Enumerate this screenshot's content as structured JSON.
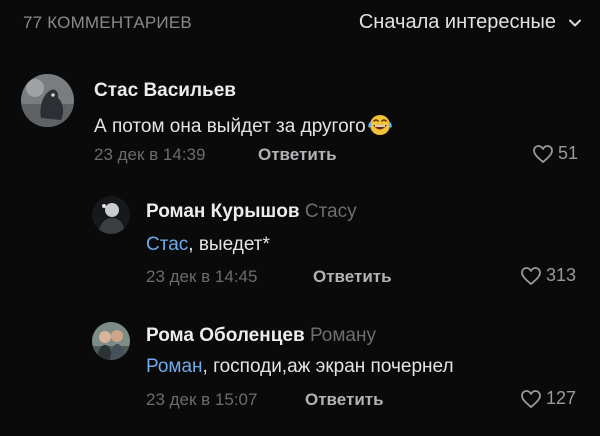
{
  "header": {
    "comment_count": "77 КОММЕНТАРИЕВ",
    "sort_label": "Сначала интересные"
  },
  "comments": [
    {
      "author": "Стас Васильев",
      "text": "А потом она выйдет за другого",
      "emoji": "😂",
      "date": "23 дек в 14:39",
      "reply_label": "Ответить",
      "likes": "51"
    },
    {
      "author": "Роман Курышов",
      "reply_to": "Стасу",
      "mention": "Стас",
      "text": ", выедет*",
      "date": "23 дек в 14:45",
      "reply_label": "Ответить",
      "likes": "313"
    },
    {
      "author": "Рома Оболенцев",
      "reply_to": "Роману",
      "mention": "Роман",
      "text": ", господи,аж экран почернел",
      "date": "23 дек в 15:07",
      "reply_label": "Ответить",
      "likes": "127"
    }
  ],
  "colors": {
    "background": "#0a0a0a",
    "mention": "#71aaeb",
    "secondary_text": "#6c6c70"
  }
}
